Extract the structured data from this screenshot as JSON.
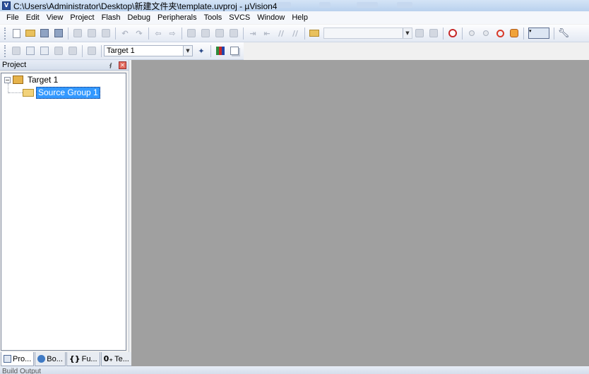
{
  "window": {
    "title": "C:\\Users\\Administrator\\Desktop\\新建文件夹\\template.uvproj - µVision4",
    "app_icon": "uvision-icon"
  },
  "menu": [
    "File",
    "Edit",
    "View",
    "Project",
    "Flash",
    "Debug",
    "Peripherals",
    "Tools",
    "SVCS",
    "Window",
    "Help"
  ],
  "toolbar2": {
    "target_select": "Target 1"
  },
  "project_panel": {
    "title": "Project",
    "pin_glyph": "⨐",
    "close_glyph": "✕",
    "tree": {
      "root_expander": "−",
      "root_label": "Target 1",
      "child_label": "Source Group 1"
    },
    "tabs": [
      {
        "label": "Pro...",
        "glyph": ""
      },
      {
        "label": "Bo...",
        "glyph": ""
      },
      {
        "label": "Fu...",
        "glyph": "{}"
      },
      {
        "label": "Te...",
        "glyph": "0₊"
      }
    ]
  },
  "build_output": {
    "label": "Build Output"
  },
  "colors": {
    "editor_background": "#a0a0a0",
    "selection": "#3399ff"
  }
}
